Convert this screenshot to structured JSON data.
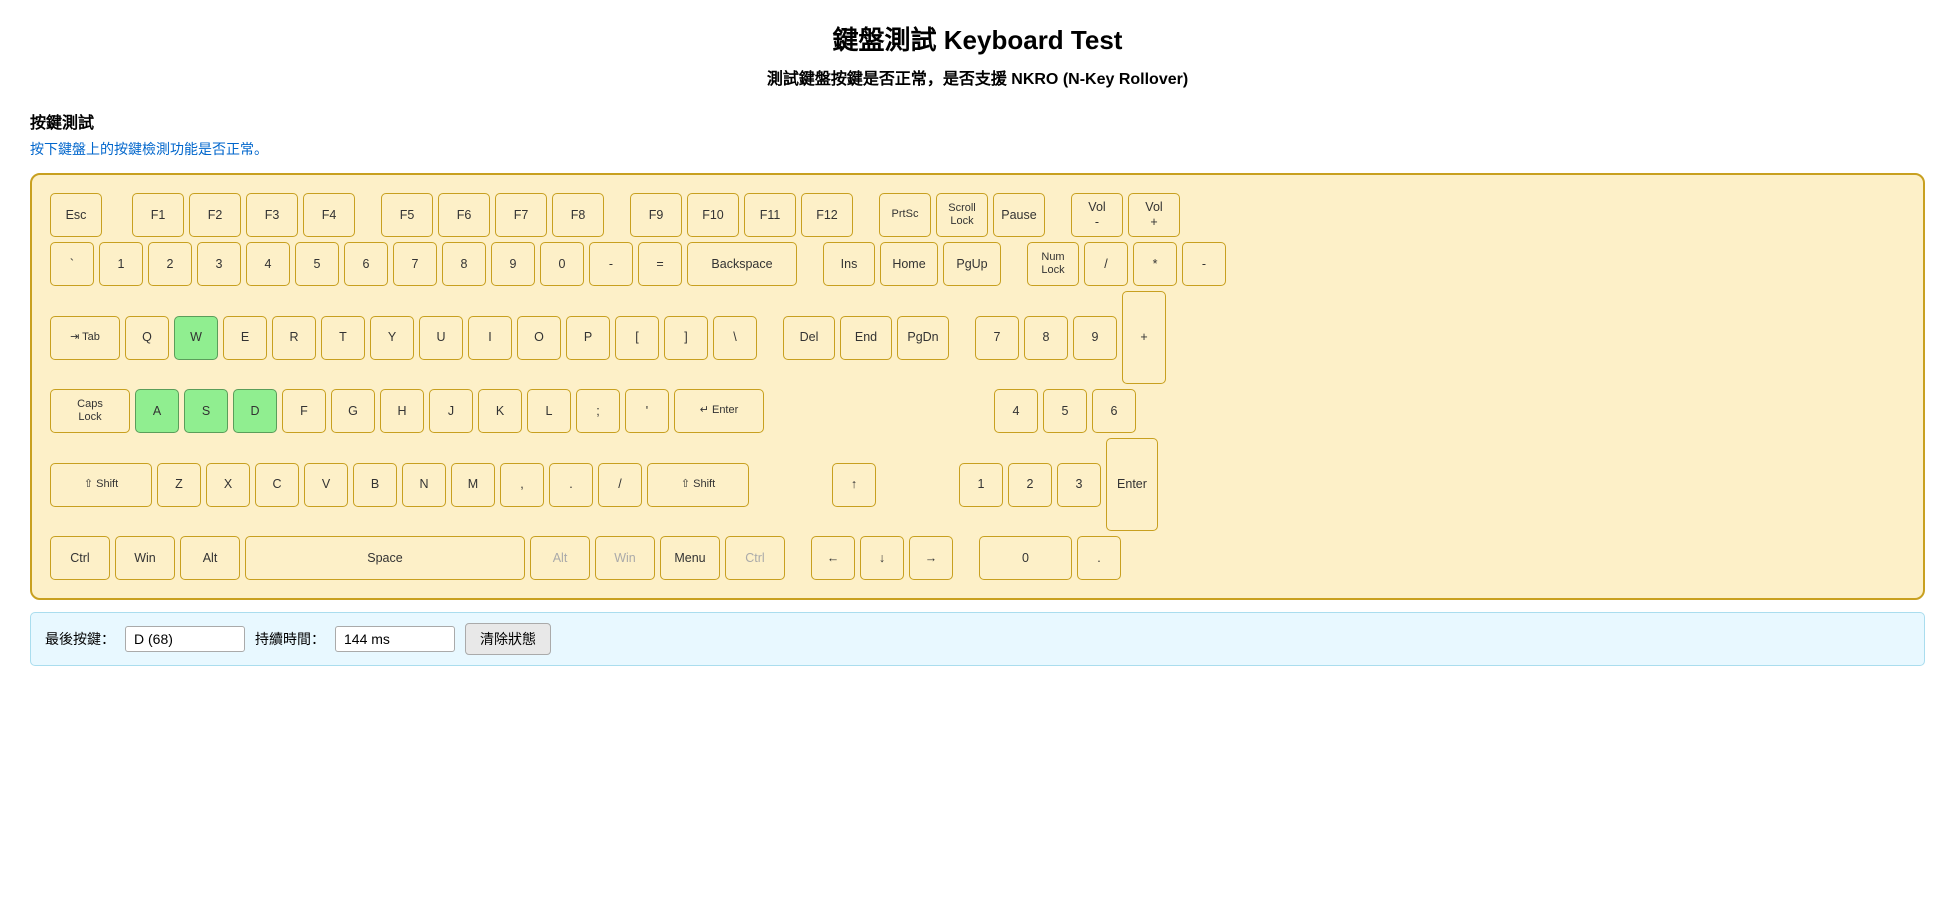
{
  "header": {
    "title": "鍵盤測試 Keyboard Test",
    "subtitle": "測試鍵盤按鍵是否正常，是否支援 NKRO (N-Key Rollover)"
  },
  "section": {
    "title": "按鍵測試",
    "description": "按下鍵盤上的按鍵檢測功能是否正常。"
  },
  "status": {
    "last_key_label": "最後按鍵：",
    "last_key_value": "D (68)",
    "duration_label": "持續時間：",
    "duration_value": "144 ms",
    "clear_button": "清除狀態"
  },
  "keyboard": {
    "rows": [
      [
        "Esc",
        "",
        "F1",
        "F2",
        "F3",
        "F4",
        "",
        "F5",
        "F6",
        "F7",
        "F8",
        "",
        "F9",
        "F10",
        "F11",
        "F12",
        "",
        "PrtSc",
        "Scroll\nLock",
        "Pause",
        "",
        "Vol\n-",
        "Vol\n+"
      ],
      [
        "`",
        "1",
        "2",
        "3",
        "4",
        "5",
        "6",
        "7",
        "8",
        "9",
        "0",
        "-",
        "=",
        "Backspace",
        "",
        "Ins",
        "Home",
        "PgUp",
        "",
        "Num\nLock",
        "/",
        "*",
        "-"
      ],
      [
        "⇥ Tab",
        "Q",
        "W",
        "E",
        "R",
        "T",
        "Y",
        "U",
        "I",
        "O",
        "P",
        "[",
        "]",
        "\\",
        "",
        "Del",
        "End",
        "PgDn",
        "",
        "7",
        "8",
        "9",
        "+"
      ],
      [
        "Caps\nLock",
        "A",
        "S",
        "D",
        "F",
        "G",
        "H",
        "J",
        "K",
        "L",
        ";",
        "'",
        "↵ Enter",
        "",
        "",
        "",
        "",
        "",
        "4",
        "5",
        "6"
      ],
      [
        "⇧ Shift",
        "Z",
        "X",
        "C",
        "V",
        "B",
        "N",
        "M",
        ",",
        ".",
        "/",
        "⇧ Shift",
        "",
        "",
        "↑",
        "",
        "",
        "1",
        "2",
        "3",
        "Enter"
      ],
      [
        "Ctrl",
        "Win",
        "Alt",
        "Space",
        "",
        "Alt",
        "Win",
        "Menu",
        "Ctrl",
        "",
        "←",
        "↓",
        "→",
        "",
        "0",
        "."
      ]
    ]
  }
}
